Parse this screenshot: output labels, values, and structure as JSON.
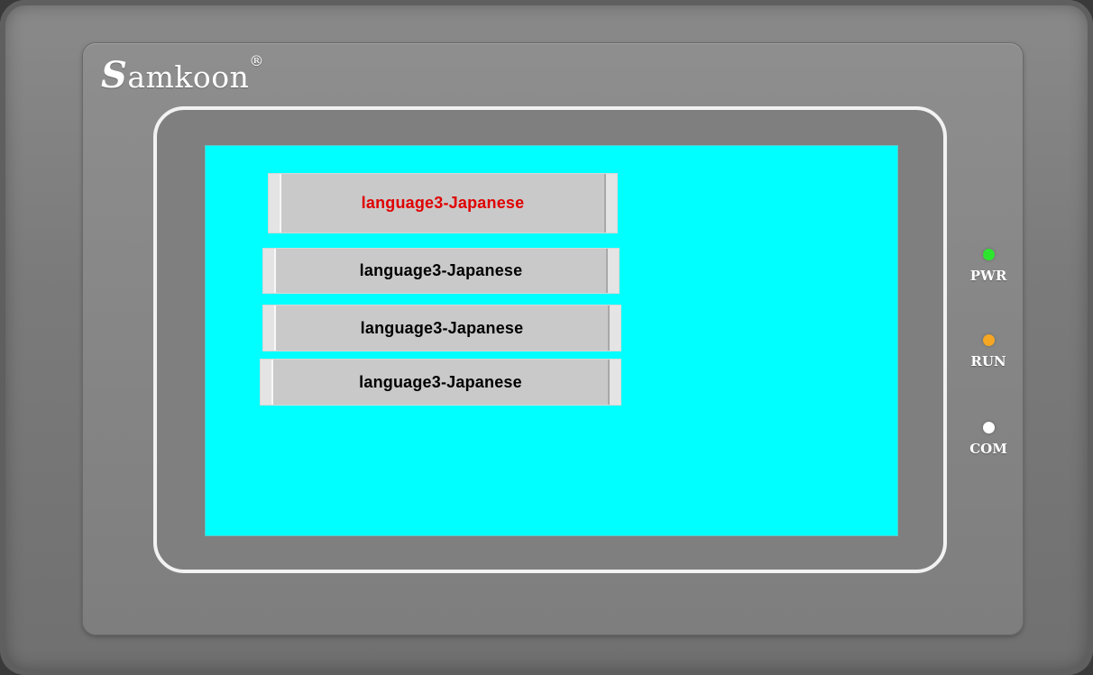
{
  "device": {
    "brand_initial": "S",
    "brand_rest": "amkoon",
    "brand_mark": "®"
  },
  "screen": {
    "background_color": "#00ffff",
    "buttons": [
      {
        "label": "language3-Japanese",
        "selected": true,
        "text_color": "#e00000"
      },
      {
        "label": "language3-Japanese",
        "selected": false,
        "text_color": "#000000"
      },
      {
        "label": "language3-Japanese",
        "selected": false,
        "text_color": "#000000"
      },
      {
        "label": "language3-Japanese",
        "selected": false,
        "text_color": "#000000"
      }
    ]
  },
  "indicators": [
    {
      "label": "PWR",
      "color": "#2ee52e"
    },
    {
      "label": "RUN",
      "color": "#f5a623"
    },
    {
      "label": "COM",
      "color": "#ffffff"
    }
  ]
}
